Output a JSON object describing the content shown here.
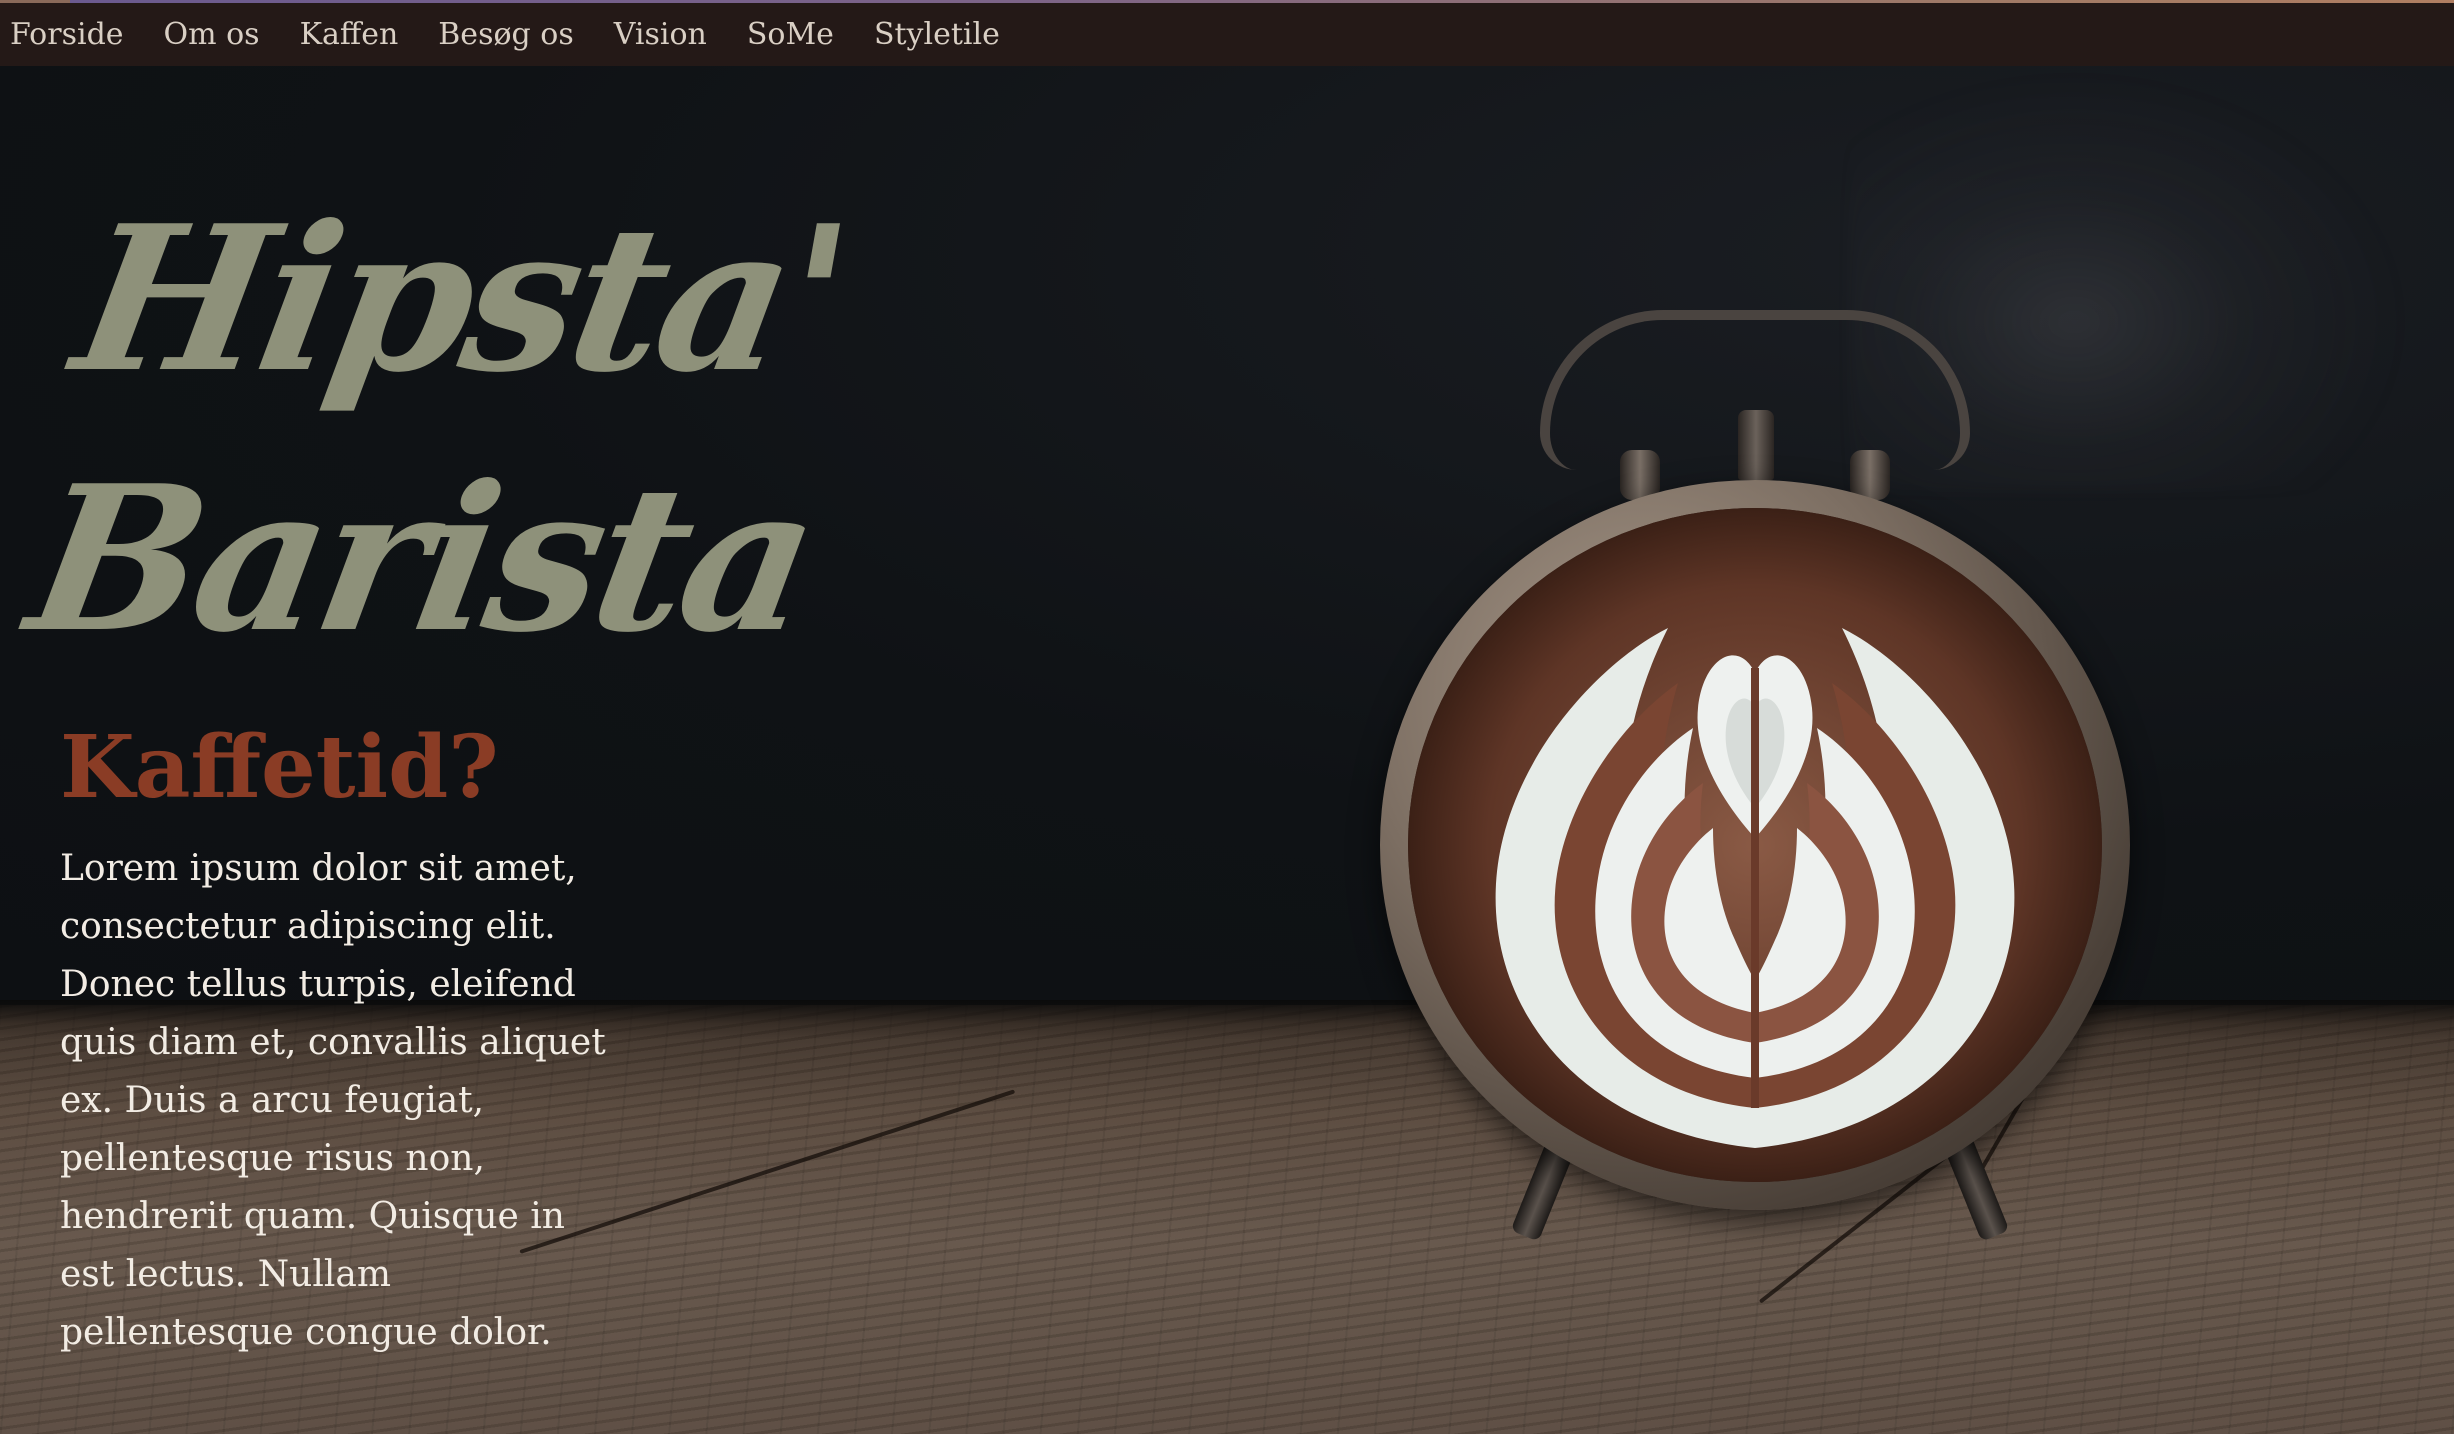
{
  "nav": {
    "items": [
      {
        "label": "Forside"
      },
      {
        "label": "Om os"
      },
      {
        "label": "Kaffen"
      },
      {
        "label": "Besøg os"
      },
      {
        "label": "Vision"
      },
      {
        "label": "SoMe"
      },
      {
        "label": "Styletile"
      }
    ]
  },
  "hero": {
    "title_line1": "Hipsta'",
    "title_line2": "Barista",
    "subtitle": "Kaffetid?",
    "body": "Lorem ipsum dolor sit amet, consectetur adipiscing elit. Donec tellus turpis, eleifend quis diam et, convallis aliquet ex. Duis a arcu feugiat, pellentesque risus non, hendrerit quam. Quisque in est lectus. Nullam pellentesque congue dolor."
  },
  "colors": {
    "nav_bg": "#241917",
    "title": "#8e917a",
    "subtitle": "#8a3c25",
    "body_text": "#f2ece4"
  },
  "image": {
    "subject": "alarm-clock-with-latte-art-face"
  }
}
